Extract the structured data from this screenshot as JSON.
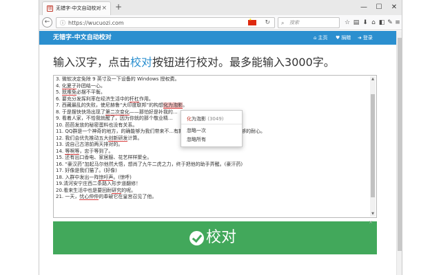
{
  "browser": {
    "tab_title": "无错字-中文自动校对",
    "favicon": "错",
    "tab_close": "×",
    "new_tab": "+",
    "minimize": "—",
    "maximize": "☐",
    "close": "✕",
    "url": "https://wucuozi.com",
    "search_placeholder": "搜索",
    "back_glyph": "←",
    "reload_glyph": "↻",
    "info_glyph": "ⓘ",
    "search_glyph": "⌕",
    "toolbar_icons": [
      "star-icon",
      "library-icon",
      "download-icon",
      "home-icon",
      "sidebar-icon",
      "extension-icon",
      "menu-icon"
    ],
    "toolbar_glyphs": [
      "☆",
      "▤",
      "⬇",
      "⌂",
      "◧",
      "✎",
      "≡"
    ]
  },
  "site": {
    "logo": "无错字-中文自动校对",
    "nav": [
      {
        "icon": "⌂",
        "label": "主页"
      },
      {
        "icon": "♥",
        "label": "捐赠"
      },
      {
        "icon": "➜",
        "label": "登录"
      }
    ],
    "headline_pre": "输入汉字，点击",
    "headline_link": "校对",
    "headline_post": "按钮进行校对。最多能输入3000字。",
    "lines": [
      [
        {
          "t": "3. 微软决定免除 9 英寸及一下设备的 Windows 授权费。"
        }
      ],
      [
        {
          "t": "4. "
        },
        {
          "t": "化夏子",
          "e": 1
        },
        {
          "t": "孙团结一心。"
        }
      ],
      [
        {
          "t": "5. "
        },
        {
          "t": "就难免",
          "e": 1
        },
        {
          "t": "必摆不平衡。"
        }
      ],
      [
        {
          "t": "6. 要充分发挥利率在经济生活中的"
        },
        {
          "t": "杆杠",
          "e": 1
        },
        {
          "t": "作用。"
        }
      ],
      [
        {
          "t": "7. 西藏最乱的失败，使尼赫鲁“大印度联邦”的构想"
        },
        {
          "t": "化为泡影",
          "h": 1
        },
        {
          "t": "。"
        }
      ],
      [
        {
          "t": "8. 于是摆快快场出现了"
        },
        {
          "t": "第二次变化",
          "e": 1
        },
        {
          "t": "——那怕好是补我的..."
        }
      ],
      [
        {
          "t": "9. 看着人家，不恰我就醒了，因为你就的那个敬业精..."
        }
      ],
      [
        {
          "t": "10. 芭芭发放的秘密蛋料也没有关系。"
        }
      ],
      [
        {
          "t": "11. QQ群是一个神奇的地方，的确能够为我们带来不...有新的乐趣方法和技巧，拥有足够的耐心。"
        }
      ],
      [
        {
          "t": "12. 我们会优先推动五大"
        },
        {
          "t": "创新研发",
          "e": 1
        },
        {
          "t": "计算。"
        }
      ],
      [
        {
          "t": "13. 说自己古溶前两天排对的。"
        }
      ],
      [
        {
          "t": "14. "
        },
        {
          "t": "等啊等",
          "e": 1
        },
        {
          "t": "，忠于等到了。"
        }
      ],
      [
        {
          "t": "15. 还有出口香电、家居服、花艺样样聚全。"
        }
      ],
      [
        {
          "t": "16. “豪汉药”加起马尔他然大悟，想尚了九牛二虎之力，终于把他的助手弄醒。(豪汗药)"
        }
      ],
      [
        {
          "t": "17. 好像是我们猫了。(好像)"
        }
      ],
      [
        {
          "t": "18. 入群中发出一阵"
        },
        {
          "t": "惊吁声",
          "e": 1
        },
        {
          "t": "。(惊呼)"
        }
      ],
      [
        {
          "t": "19.清河安宁庄西二条路入形步道翻修！"
        }
      ],
      [
        {
          "t": "20.看来生活中也是要回耐"
        },
        {
          "t": "研究",
          "e": 1
        },
        {
          "t": "的呢。"
        }
      ],
      [
        {
          "t": "21. 一天，"
        },
        {
          "t": "忧心仲仲",
          "e": 1
        },
        {
          "t": "的奉破它在皇宫召见了他。"
        }
      ]
    ],
    "context_menu": {
      "suggestion_red": "化",
      "suggestion_rest": "为泡影",
      "count": "(3049)",
      "ignore_once": "忽略一次",
      "ignore_all": "忽略所有"
    },
    "check_button": "校对",
    "dismiss": "×",
    "scroll_up": "▲",
    "scroll_down": "▼"
  },
  "colors": {
    "brand_blue": "#2b8fcf",
    "button_green": "#42a85b",
    "error_red": "#d83a3a"
  }
}
